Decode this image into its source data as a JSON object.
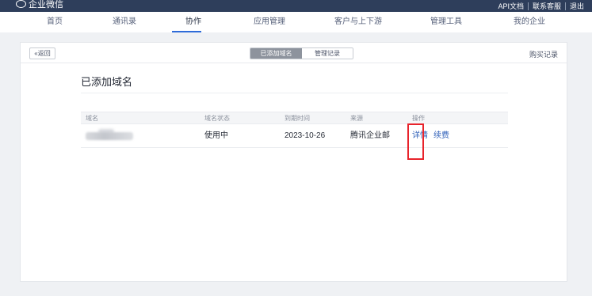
{
  "app": {
    "logo_text": "企业微信",
    "top_links": [
      "API文档",
      "联系客服",
      "退出"
    ]
  },
  "nav": {
    "items": [
      "首页",
      "通讯录",
      "协作",
      "应用管理",
      "客户与上下游",
      "管理工具",
      "我的企业"
    ],
    "active": "协作"
  },
  "toolbar": {
    "back_label": "«返回",
    "tabs": [
      "已添加域名",
      "管理记录"
    ],
    "active_tab": "已添加域名",
    "buy_records": "购买记录"
  },
  "page": {
    "title": "已添加域名"
  },
  "table": {
    "headers": [
      "域名",
      "域名状态",
      "到期时间",
      "来源",
      "操作"
    ],
    "rows": [
      {
        "domain": "",
        "status": "使用中",
        "expiry": "2023-10-26",
        "source": "腾讯企业邮",
        "actions": [
          "详情",
          "续费"
        ]
      }
    ]
  },
  "colors": {
    "topbar": "#2e3e5b",
    "accent": "#2e6bd9",
    "link": "#2e5fb8",
    "highlight_box": "#e8232b"
  }
}
